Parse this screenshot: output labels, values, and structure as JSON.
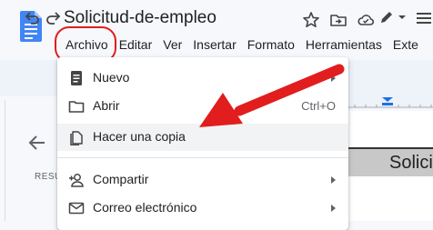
{
  "header": {
    "title": "Solicitud-de-empleo",
    "icons": [
      "star-icon",
      "move-to-folder-icon",
      "cloud-saved-icon"
    ]
  },
  "menubar": {
    "items": [
      "Archivo",
      "Editar",
      "Ver",
      "Insertar",
      "Formato",
      "Herramientas",
      "Exte"
    ]
  },
  "file_menu": {
    "items": [
      {
        "label": "Nuevo",
        "icon": "document-icon",
        "submenu": true
      },
      {
        "label": "Abrir",
        "icon": "folder-icon",
        "shortcut": "Ctrl+O"
      },
      {
        "label": "Hacer una copia",
        "icon": "copy-icon",
        "highlighted": true
      },
      {
        "label": "Compartir",
        "icon": "person-add-icon",
        "submenu": true
      },
      {
        "label": "Correo electrónico",
        "icon": "mail-icon",
        "submenu": true
      }
    ]
  },
  "side_panel": {
    "label": "RESU"
  },
  "document": {
    "heading": "Solici"
  },
  "colors": {
    "accent": "#4285f4",
    "annotation_red": "#e11d1d",
    "highlight": "#f1f3f4"
  }
}
